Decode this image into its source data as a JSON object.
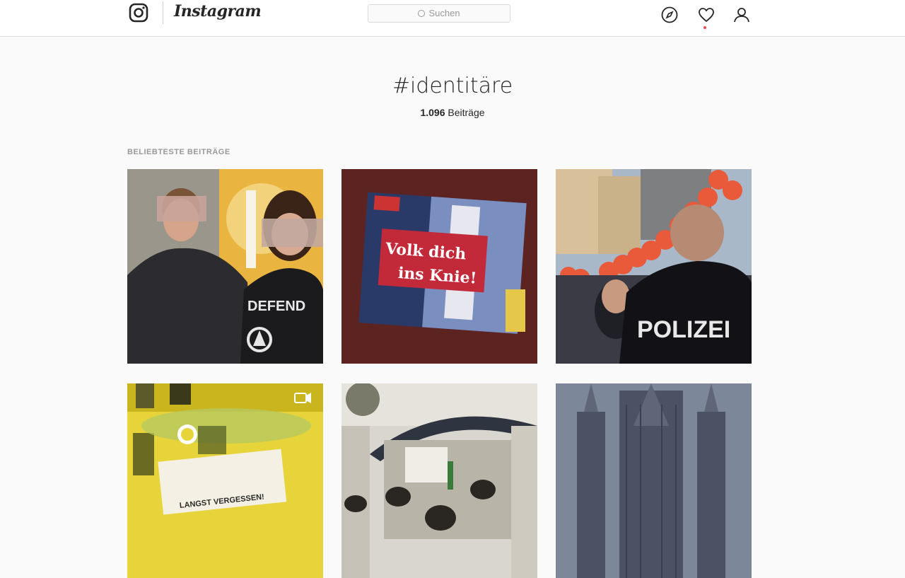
{
  "app": {
    "name": "Instagram"
  },
  "header": {
    "search_placeholder": "Suchen",
    "icons": [
      "explore-icon",
      "heart-icon",
      "profile-icon"
    ]
  },
  "hashtag": {
    "title": "#identitäre",
    "count": "1.096",
    "count_label": " Beiträge"
  },
  "section": {
    "label": "BELIEBTESTE BEITRÄGE"
  },
  "posts": [
    {
      "id": 1,
      "shirt_text": "DEFEND"
    },
    {
      "id": 2,
      "sticker_line1": "Volk dich",
      "sticker_line2": "ins Knie!"
    },
    {
      "id": 3,
      "vest_text": "POLIZEI"
    },
    {
      "id": 4,
      "banner_line1": "LANGST VERGESSEN!",
      "badge": "video-icon"
    },
    {
      "id": 5
    },
    {
      "id": 6
    }
  ],
  "colors": {
    "accent_dot": "#ed4956",
    "text": "#262626",
    "muted": "#999999"
  }
}
